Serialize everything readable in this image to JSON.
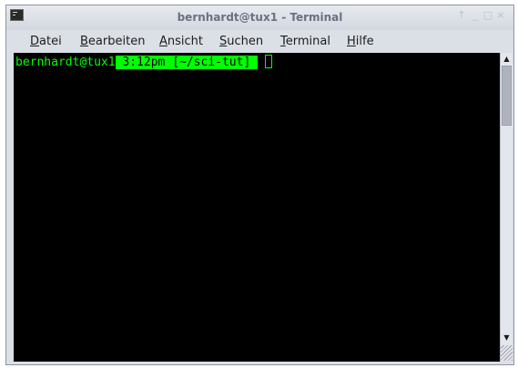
{
  "window": {
    "title": "bernhardt@tux1 - Terminal",
    "buttons": {
      "keep_above": "↑",
      "minimize": "_",
      "maximize": "□",
      "close": "×"
    }
  },
  "menubar": {
    "items": [
      {
        "accel": "D",
        "rest": "atei"
      },
      {
        "accel": "B",
        "rest": "earbeiten"
      },
      {
        "accel": "A",
        "rest": "nsicht"
      },
      {
        "accel": "S",
        "rest": "uchen"
      },
      {
        "accel": "T",
        "rest": "erminal"
      },
      {
        "accel": "H",
        "rest": "ilfe"
      }
    ]
  },
  "terminal": {
    "prompt_user": "bernhardt@tux1",
    "prompt_highlight": " 3:12pm [~/sci-tut] "
  },
  "scrollbar": {
    "up_arrow": "▲",
    "down_arrow": "▼"
  },
  "colors": {
    "terminal_bg": "#000000",
    "prompt_green": "#00ff00",
    "chrome": "#dbdfe6"
  },
  "icons": [
    "terminal-app-icon",
    "scroll-up-arrow-icon",
    "scroll-down-arrow-icon",
    "resize-grip-icon"
  ]
}
